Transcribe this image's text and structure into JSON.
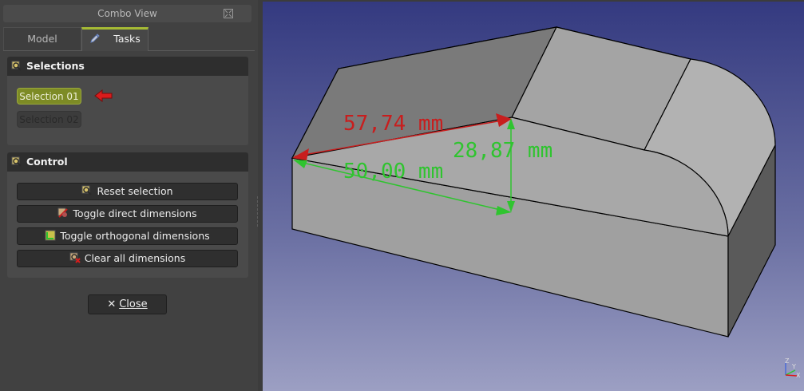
{
  "combo_view": {
    "title": "Combo View",
    "tabs": [
      {
        "label": "Model",
        "active": false
      },
      {
        "label": "Tasks",
        "active": true
      }
    ]
  },
  "selections": {
    "title": "Selections",
    "items": [
      {
        "label": "Selection 01",
        "state": "active"
      },
      {
        "label": "Selection 02",
        "state": "disabled"
      }
    ]
  },
  "control": {
    "title": "Control",
    "buttons": [
      {
        "label": "Reset selection",
        "icon": "reset-selection-icon"
      },
      {
        "label": "Toggle direct dimensions",
        "icon": "toggle-direct-icon"
      },
      {
        "label": "Toggle orthogonal dimensions",
        "icon": "toggle-orthogonal-icon"
      },
      {
        "label": "Clear all dimensions",
        "icon": "clear-dimensions-icon"
      }
    ]
  },
  "close_button": {
    "label": "Close",
    "icon": "close-x-icon"
  },
  "viewport": {
    "dimensions": [
      {
        "text": "57,74 mm",
        "color": "#c81e1e",
        "kind": "direct"
      },
      {
        "text": "28,87 mm",
        "color": "#2fc42f",
        "kind": "orthogonal"
      },
      {
        "text": "50,00 mm",
        "color": "#2fc42f",
        "kind": "orthogonal"
      }
    ],
    "axis_labels": {
      "z": "Z",
      "y": "Y",
      "x": "X"
    }
  },
  "colors": {
    "accent": "#a6bb35",
    "selection_active": "#7d8b25",
    "direct_dimension": "#c81e1e",
    "orthogonal_dimension": "#2fc42f",
    "background_top": "#343a80",
    "background_bottom": "#9c9fc3"
  }
}
